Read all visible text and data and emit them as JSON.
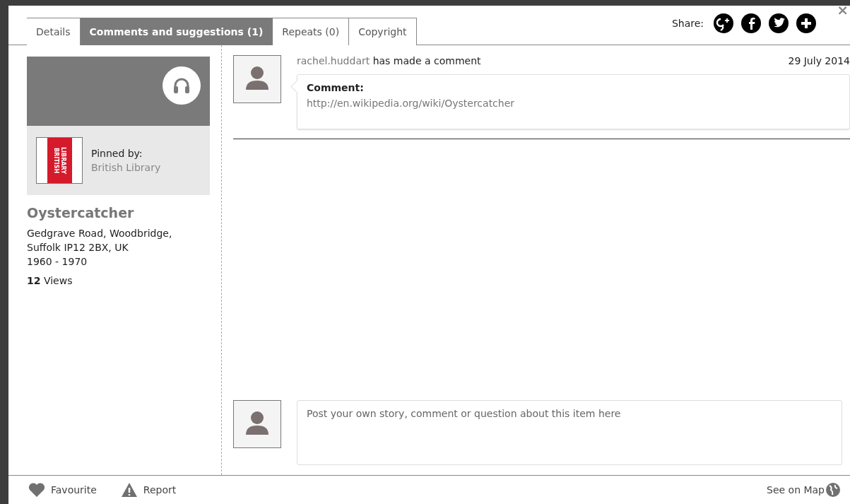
{
  "tabs": [
    {
      "label": "Details",
      "selected": false
    },
    {
      "label": "Comments and suggestions (1)",
      "selected": true
    },
    {
      "label": "Repeats (0)",
      "selected": false
    },
    {
      "label": "Copyright",
      "selected": false
    }
  ],
  "share": {
    "label": "Share:",
    "networks": [
      {
        "kind": "googleplus"
      },
      {
        "kind": "facebook"
      },
      {
        "kind": "twitter"
      },
      {
        "kind": "more"
      }
    ]
  },
  "close": "×",
  "item": {
    "pinned_by_label": "Pinned by:",
    "pinned_by": "British Library",
    "logo_text": [
      "LIBRARY",
      "BRITISH"
    ],
    "title": "Oystercatcher",
    "address_lines": [
      "Gedgrave Road, Woodbridge,",
      "Suffolk IP12 2BX, UK",
      "1960 - 1970"
    ],
    "views_count": "12",
    "views_label": "Views"
  },
  "comments": [
    {
      "user": "rachel.huddart",
      "action": "has made a comment",
      "date": "29 July 2014",
      "heading": "Comment:",
      "body": "http://en.wikipedia.org/wiki/Oystercatcher"
    }
  ],
  "composer": {
    "placeholder": "Post your own story, comment or question about this item here"
  },
  "footer": {
    "favourite": "Favourite",
    "report": "Report",
    "map": "See on Map"
  }
}
